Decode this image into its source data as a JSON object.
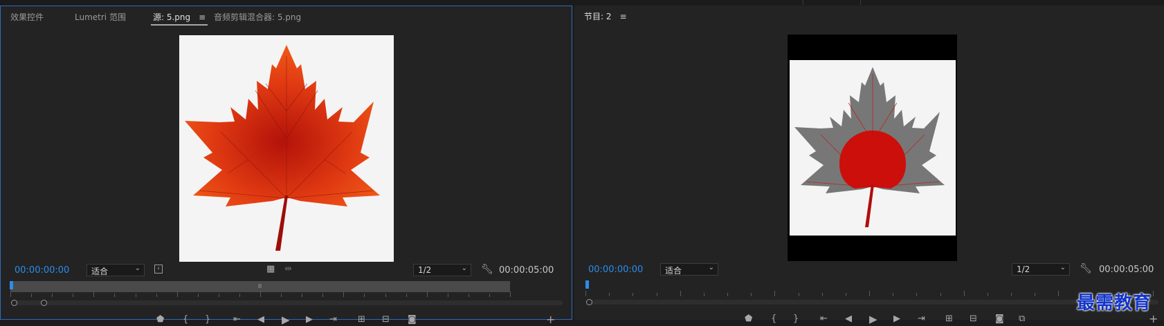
{
  "source_panel": {
    "tabs": [
      {
        "label": "效果控件"
      },
      {
        "label": "Lumetri 范围"
      },
      {
        "label": "源: 5.png"
      },
      {
        "label": "音频剪辑混合器: 5.png"
      }
    ],
    "timecode": "00:00:00:00",
    "zoom_select": "适合",
    "resolution_select": "1/2",
    "duration": "00:00:05:00",
    "image_icon": "maple-leaf-red"
  },
  "program_panel": {
    "title": "节目: 2",
    "timecode": "00:00:00:00",
    "zoom_select": "适合",
    "resolution_select": "1/2",
    "duration": "00:00:05:00",
    "image_icon": "maple-leaf-gray-red-partial"
  },
  "watermark": "最需教育",
  "colors": {
    "accent": "#2d8ceb",
    "panel_bg": "#232323",
    "active_border": "#2e6cbf"
  }
}
